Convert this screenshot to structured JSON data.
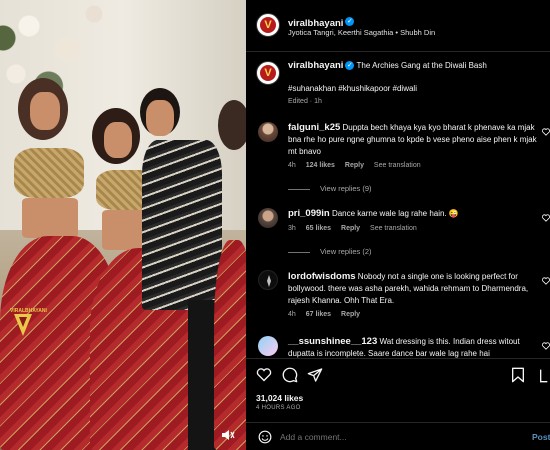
{
  "header": {
    "username": "viralbhayani",
    "subtitle": "Jyotica Tangri, Keerthi Sagathia • Shubh Din"
  },
  "caption": {
    "username": "viralbhayani",
    "text": "The Archies Gang at the Diwali Bash",
    "hashtags": "#suhanakhan #khushikapoor #diwali",
    "meta": "Edited · 1h"
  },
  "comments": [
    {
      "username": "falguni_k25",
      "text": "Duppta bech khaya kya kyo bharat k phenave ka mjak bna rhe ho pure ngne ghumna to kpde b vese pheno aise phen k mjak mt bnavo",
      "time": "4h",
      "likes": "124 likes",
      "reply": "Reply",
      "translate": "See translation",
      "view_replies": "View replies (9)"
    },
    {
      "username": "pri_099in",
      "text": "Dance karne wale lag rahe hain. 😜",
      "time": "3h",
      "likes": "65 likes",
      "reply": "Reply",
      "translate": "See translation",
      "view_replies": "View replies (2)"
    },
    {
      "username": "lordofwisdoms",
      "text": "Nobody not a single one is looking perfect for bollywood. there was asha parekh, wahida rehmam to Dharmendra, rajesh Khanna. Ohh That Era.",
      "time": "4h",
      "likes": "67 likes",
      "reply": "Reply"
    },
    {
      "username": "__ssunshinee__123",
      "text": "Wat dressing is this. Indian dress witout dupatta is incomplete. Saare dance bar wale lag rahe hai"
    }
  ],
  "actions": {
    "likes": "31,024 likes",
    "date": "4 HOURS AGO"
  },
  "add_comment": {
    "placeholder": "Add a comment...",
    "post_label": "Post"
  },
  "media": {
    "watermark": "VIRALBHAYANI"
  },
  "colors": {
    "background": "#000000",
    "link_blue": "#0095f6",
    "muted_text": "#a8a8a8"
  },
  "icons": [
    "heart-icon",
    "comment-icon",
    "share-icon",
    "bookmark-icon",
    "emoji-icon",
    "mute-icon",
    "verified-icon"
  ]
}
